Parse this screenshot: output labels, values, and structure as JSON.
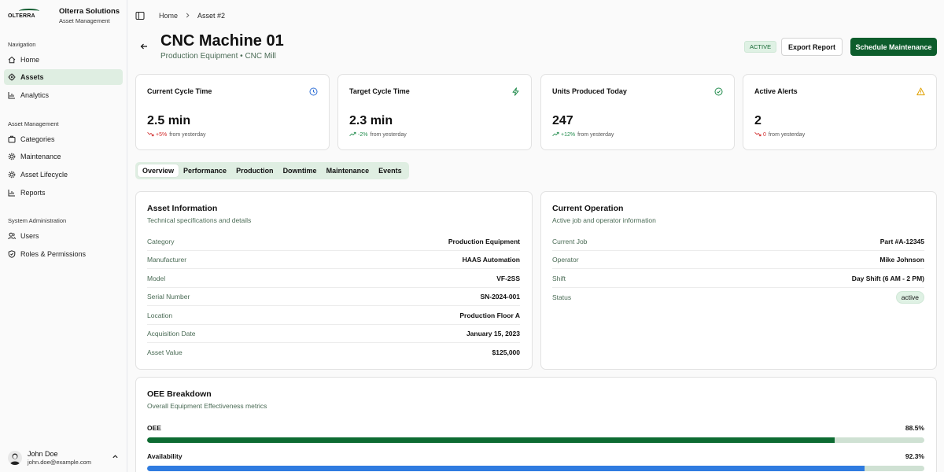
{
  "brand": {
    "logo_text": "OLTERRA",
    "name": "Olterra Solutions",
    "subtitle": "Asset Management"
  },
  "sidebar": {
    "sections": [
      {
        "title": "Navigation",
        "items": [
          {
            "label": "Home",
            "icon": "home-icon"
          },
          {
            "label": "Assets",
            "icon": "assets-icon",
            "active": true
          },
          {
            "label": "Analytics",
            "icon": "analytics-icon"
          }
        ]
      },
      {
        "title": "Asset Management",
        "items": [
          {
            "label": "Categories",
            "icon": "categories-icon"
          },
          {
            "label": "Maintenance",
            "icon": "maintenance-icon"
          },
          {
            "label": "Asset Lifecycle",
            "icon": "lifecycle-icon"
          },
          {
            "label": "Reports",
            "icon": "reports-icon"
          }
        ]
      },
      {
        "title": "System Administration",
        "items": [
          {
            "label": "Users",
            "icon": "users-icon"
          },
          {
            "label": "Roles & Permissions",
            "icon": "shield-icon"
          }
        ]
      }
    ]
  },
  "user": {
    "name": "John Doe",
    "email": "john.doe@example.com"
  },
  "breadcrumb": {
    "home": "Home",
    "current": "Asset #2"
  },
  "header": {
    "title": "CNC Machine 01",
    "subtitle": "Production Equipment • CNC Mill",
    "status": "ACTIVE",
    "export_label": "Export Report",
    "schedule_label": "Schedule Maintenance"
  },
  "stats": [
    {
      "label": "Current Cycle Time",
      "value": "2.5 min",
      "delta": "+5%",
      "trend": "down",
      "suffix": "from yesterday",
      "icon": "clock-icon",
      "icon_color": "#2f6fd6"
    },
    {
      "label": "Target Cycle Time",
      "value": "2.3 min",
      "delta": "-2%",
      "trend": "up",
      "suffix": "from yesterday",
      "icon": "lightning-icon",
      "icon_color": "#1e8a4a"
    },
    {
      "label": "Units Produced Today",
      "value": "247",
      "delta": "+12%",
      "trend": "up",
      "suffix": "from yesterday",
      "icon": "check-circle-icon",
      "icon_color": "#1e8a4a"
    },
    {
      "label": "Active Alerts",
      "value": "2",
      "delta": "0",
      "trend": "down",
      "suffix": "from yesterday",
      "icon": "warning-icon",
      "icon_color": "#e0a100"
    }
  ],
  "tabs": [
    "Overview",
    "Performance",
    "Production",
    "Downtime",
    "Maintenance",
    "Events"
  ],
  "asset_info": {
    "title": "Asset Information",
    "subtitle": "Technical specifications and details",
    "rows": [
      {
        "k": "Category",
        "v": "Production Equipment"
      },
      {
        "k": "Manufacturer",
        "v": "HAAS Automation"
      },
      {
        "k": "Model",
        "v": "VF-2SS"
      },
      {
        "k": "Serial Number",
        "v": "SN-2024-001"
      },
      {
        "k": "Location",
        "v": "Production Floor A"
      },
      {
        "k": "Acquisition Date",
        "v": "January 15, 2023"
      },
      {
        "k": "Asset Value",
        "v": "$125,000"
      }
    ]
  },
  "operation": {
    "title": "Current Operation",
    "subtitle": "Active job and operator information",
    "rows": [
      {
        "k": "Current Job",
        "v": "Part #A-12345"
      },
      {
        "k": "Operator",
        "v": "Mike Johnson"
      },
      {
        "k": "Shift",
        "v": "Day Shift (6 AM - 2 PM)"
      },
      {
        "k": "Status",
        "v": "active"
      }
    ]
  },
  "oee": {
    "title": "OEE Breakdown",
    "subtitle": "Overall Equipment Effectiveness metrics",
    "metrics": [
      {
        "label": "OEE",
        "value_text": "88.5%",
        "value": 88.5,
        "color": "#0d6b32"
      },
      {
        "label": "Availability",
        "value_text": "92.3%",
        "value": 92.3,
        "color": "#2f7be0"
      }
    ]
  },
  "colors": {
    "primary": "#0d5d2c",
    "accent_bg": "#dfeee2",
    "muted_text": "#4a6b55"
  }
}
